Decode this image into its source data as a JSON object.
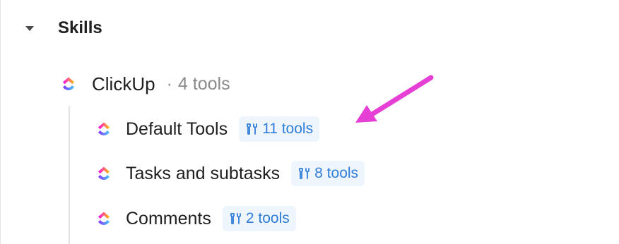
{
  "section": {
    "title": "Skills",
    "caret_icon": "caret-down-icon"
  },
  "app": {
    "name": "ClickUp",
    "separator": "·",
    "tool_count": "4 tools",
    "logo_icon": "clickup-logo-icon"
  },
  "skills": [
    {
      "name": "Default Tools",
      "badge": "11 tools",
      "logo_icon": "clickup-logo-icon",
      "badge_icon": "tools-icon"
    },
    {
      "name": "Tasks and subtasks",
      "badge": "8 tools",
      "logo_icon": "clickup-logo-icon",
      "badge_icon": "tools-icon"
    },
    {
      "name": "Comments",
      "badge": "2 tools",
      "logo_icon": "clickup-logo-icon",
      "badge_icon": "tools-icon"
    }
  ],
  "annotation": {
    "arrow_color": "#e63fd6",
    "arrow_icon": "pointer-arrow-icon"
  },
  "colors": {
    "badge_text": "#2f7ed8",
    "badge_bg": "#eef5fc",
    "muted_text": "#8a8a8a"
  }
}
